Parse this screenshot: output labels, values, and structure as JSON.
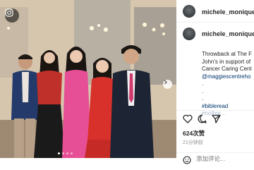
{
  "post": {
    "author_handle": "michele_monique_",
    "commenter_handle": "michele_monique_",
    "caption_lines": [
      "Throwback at The F",
      "John's in support of",
      "Cancer Caring Cent"
    ],
    "caption_mention": "@maggiescentreho",
    "caption_dots": [
      ".",
      ".",
      "."
    ],
    "hashtag": "#bibleread",
    "hashtag_partial": "#nothgr..."
  },
  "stats": {
    "likes_text": "624次赞",
    "time_text": "21分钟前"
  },
  "comment": {
    "placeholder": "添加评论..."
  },
  "icons": {
    "like": "heart-icon",
    "comment": "comment-icon",
    "share": "paper-plane-icon",
    "emoji": "emoji-icon",
    "carousel": "chevron-right-icon",
    "badge": "instagram-icon"
  }
}
